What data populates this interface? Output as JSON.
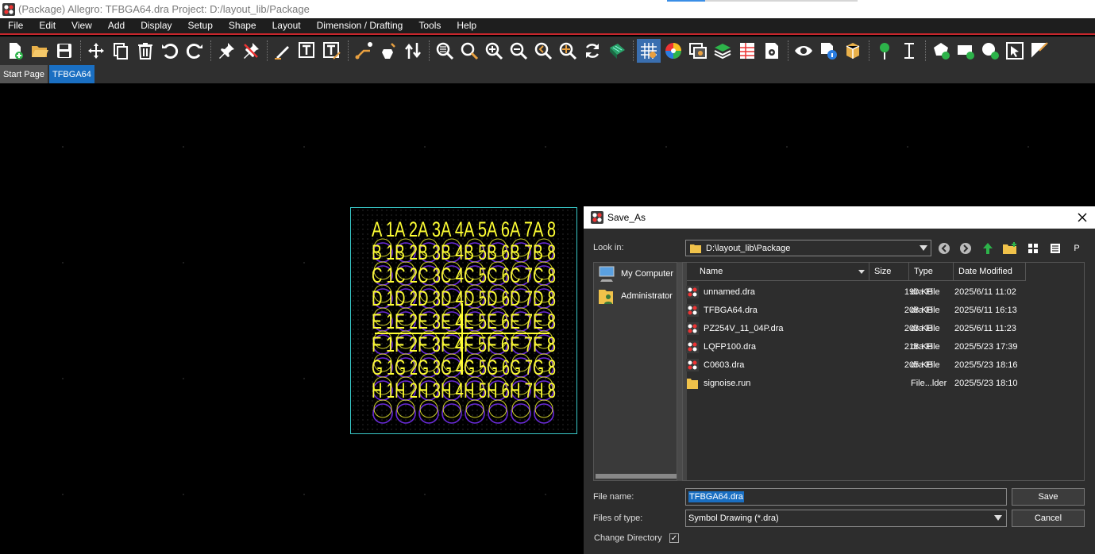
{
  "window": {
    "title": "(Package) Allegro: TFBGA64.dra  Project: D:/layout_lib/Package"
  },
  "menu": [
    "File",
    "Edit",
    "View",
    "Add",
    "Display",
    "Setup",
    "Shape",
    "Layout",
    "Dimension / Drafting",
    "Tools",
    "Help"
  ],
  "tabs": [
    {
      "label": "Start Page",
      "active": false
    },
    {
      "label": "TFBGA64",
      "active": true
    }
  ],
  "colors": {
    "accent": "#1a6fc2",
    "menu_underline": "#c8262c",
    "board_outline": "#39c8c8",
    "pin_text": "#ffff33",
    "pad_ring": "#6a2bd9"
  },
  "dialog": {
    "title": "Save_As",
    "look_in_label": "Look in:",
    "look_in_value": "D:\\layout_lib\\Package",
    "places": [
      {
        "label": "My Computer",
        "icon": "computer-icon"
      },
      {
        "label": "Administrator",
        "icon": "user-folder-icon"
      }
    ],
    "columns": [
      "Name",
      "Size",
      "Type",
      "Date Modified"
    ],
    "files": [
      {
        "name": "unnamed.dra",
        "size": "190 KB",
        "type": "dra File",
        "date": "2025/6/11 11:02",
        "icon": "allegro-file-icon"
      },
      {
        "name": "TFBGA64.dra",
        "size": "208 KB",
        "type": "dra File",
        "date": "2025/6/11 16:13",
        "icon": "allegro-file-icon"
      },
      {
        "name": "PZ254V_11_04P.dra",
        "size": "203 KB",
        "type": "dra File",
        "date": "2025/6/11 11:23",
        "icon": "allegro-file-icon"
      },
      {
        "name": "LQFP100.dra",
        "size": "218 KB",
        "type": "dra File",
        "date": "2025/5/23 17:39",
        "icon": "allegro-file-icon"
      },
      {
        "name": "C0603.dra",
        "size": "205 KB",
        "type": "dra File",
        "date": "2025/5/23 18:16",
        "icon": "allegro-file-icon"
      },
      {
        "name": "signoise.run",
        "size": "",
        "type": "File...lder",
        "date": "2025/5/23 18:10",
        "icon": "folder-icon"
      }
    ],
    "file_name_label": "File name:",
    "file_name_value": "TFBGA64.dra",
    "files_of_type_label": "Files of type:",
    "files_of_type_value": "Symbol Drawing (*.dra)",
    "change_directory_label": "Change Directory",
    "change_directory_checked": true,
    "save_label": "Save",
    "cancel_label": "Cancel",
    "view_mode_p": "P"
  },
  "package": {
    "columns_label": "A 1A 2A 3A 4A 5A 6A 7A 8",
    "rows": [
      "A",
      "B",
      "C",
      "D",
      "E",
      "F",
      "G",
      "H"
    ]
  }
}
